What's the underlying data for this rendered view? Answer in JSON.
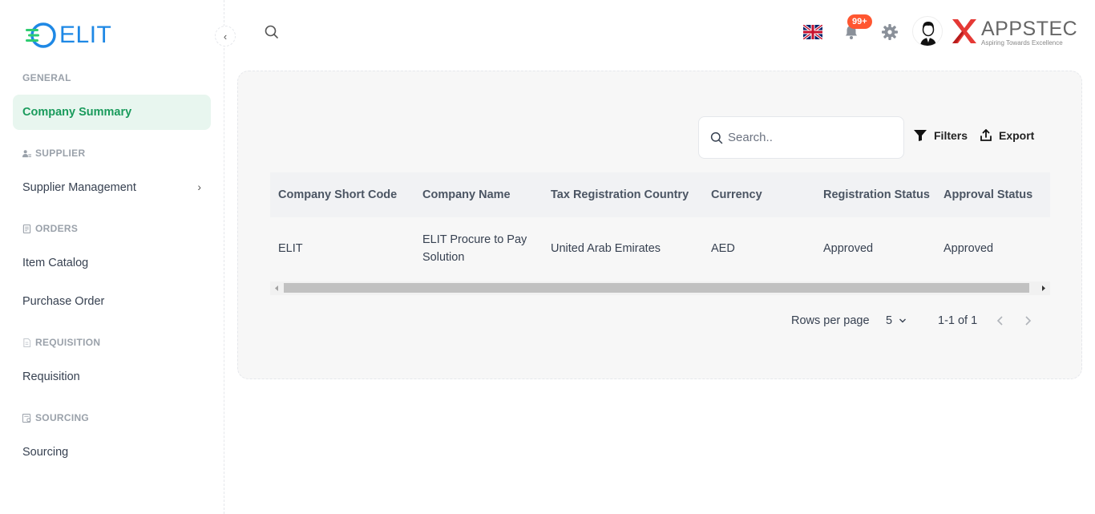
{
  "app": {
    "logo_text": "ELIT",
    "brand_name": "APPSTEC",
    "brand_tagline": "Aspiring Towards Excellence"
  },
  "sidebar": {
    "sections": {
      "general": "GENERAL",
      "supplier": "SUPPLIER",
      "orders": "ORDERS",
      "requisition": "REQUISITION",
      "sourcing": "SOURCING"
    },
    "items": {
      "company_summary": "Company Summary",
      "supplier_management": "Supplier Management",
      "item_catalog": "Item Catalog",
      "purchase_order": "Purchase Order",
      "requisition": "Requisition",
      "sourcing": "Sourcing"
    }
  },
  "header": {
    "notification_badge": "99+"
  },
  "toolbar": {
    "search_placeholder": "Search..",
    "filters_label": "Filters",
    "export_label": "Export"
  },
  "table": {
    "columns": [
      "Company Short Code",
      "Company Name",
      "Tax Registration Country",
      "Currency",
      "Registration Status",
      "Approval Status"
    ],
    "rows": [
      {
        "short_code": "ELIT",
        "name_line1": "ELIT Procure to Pay",
        "name_line2": "Solution",
        "country": "United Arab Emirates",
        "currency": "AED",
        "registration_status": "Approved",
        "approval_status": "Approved"
      }
    ]
  },
  "pagination": {
    "rows_per_page_label": "Rows per page",
    "rows_per_page_value": "5",
    "range_text": "1-1 of 1"
  },
  "colors": {
    "accent_green": "#1a9b5c",
    "active_bg": "#e8f6ef",
    "logo_blue": "#1e88e5",
    "badge_red": "#ff5630"
  }
}
